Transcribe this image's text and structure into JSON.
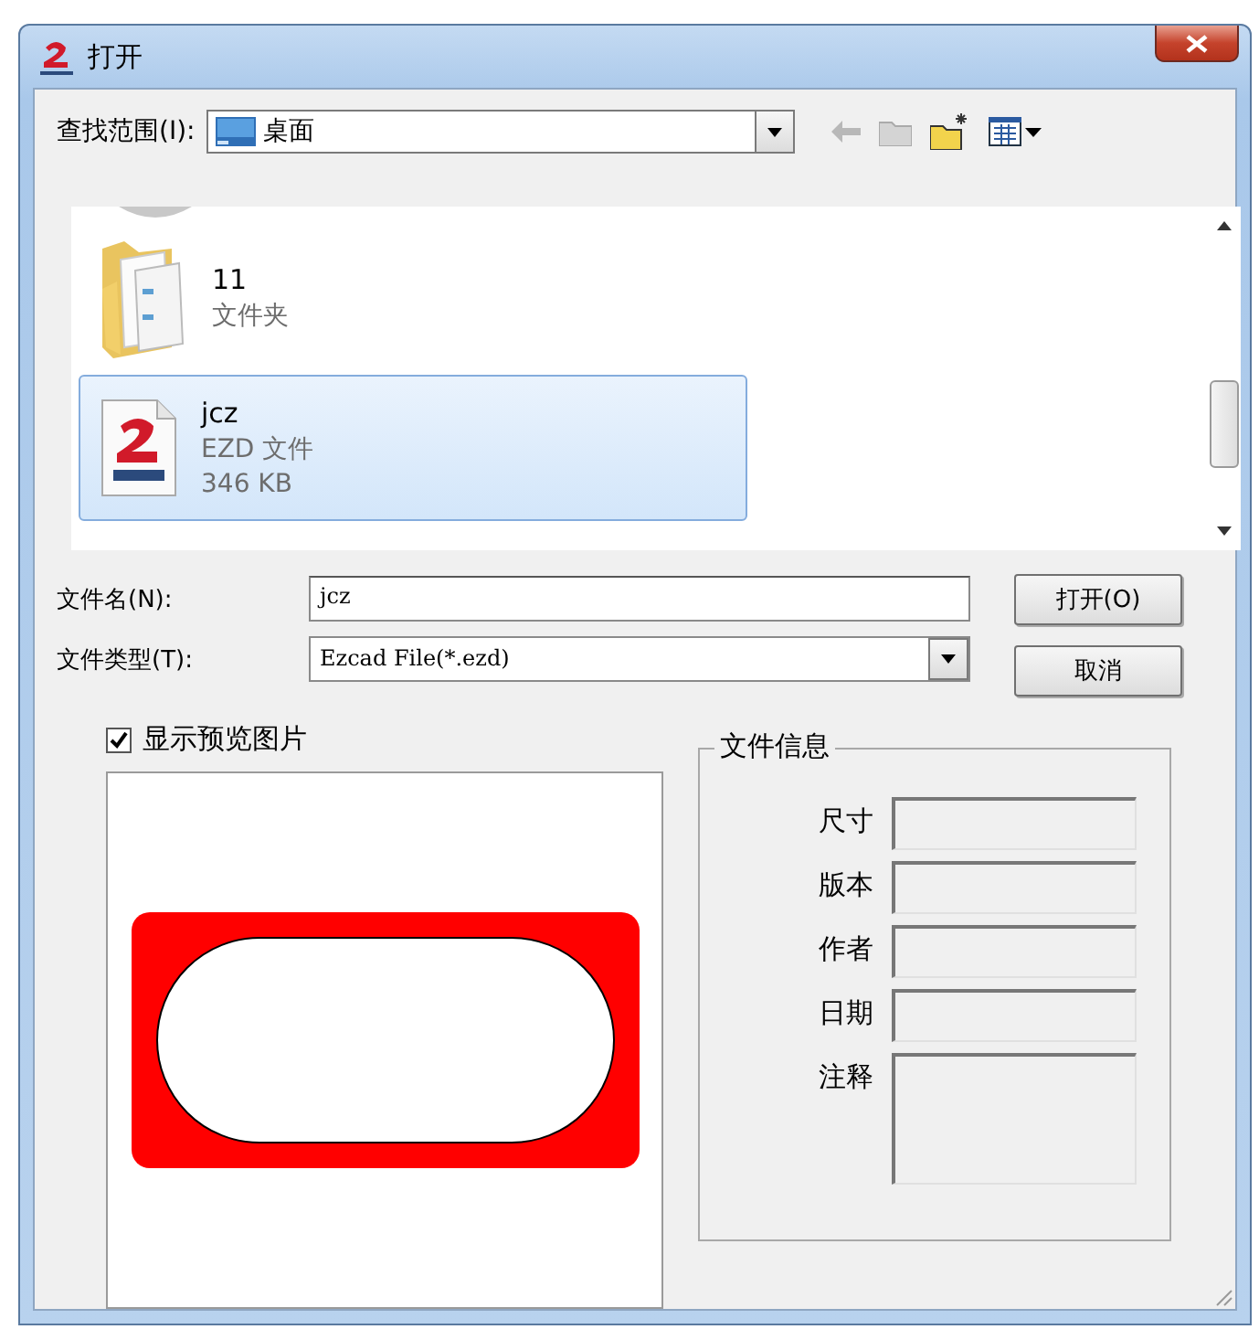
{
  "window": {
    "title": "打开"
  },
  "look_in": {
    "label": "查找范围(I):",
    "value": "桌面"
  },
  "files": [
    {
      "name": "11",
      "type": "文件夹",
      "kind": "folder",
      "selected": false
    },
    {
      "name": "jcz",
      "type": "EZD 文件",
      "size": "346 KB",
      "kind": "ezd",
      "selected": true
    }
  ],
  "file_name": {
    "label": "文件名(N):",
    "value": "jcz"
  },
  "file_type": {
    "label": "文件类型(T):",
    "value": "Ezcad File(*.ezd)"
  },
  "buttons": [
    "打开(O)",
    "取消"
  ],
  "preview": {
    "label": "显示预览图片",
    "checked": true
  },
  "file_info": {
    "title": "文件信息",
    "fields": [
      {
        "label": "尺寸",
        "kind": "line"
      },
      {
        "label": "版本",
        "kind": "line"
      },
      {
        "label": "作者",
        "kind": "line"
      },
      {
        "label": "日期",
        "kind": "line"
      },
      {
        "label": "注释",
        "kind": "multiline"
      }
    ]
  }
}
